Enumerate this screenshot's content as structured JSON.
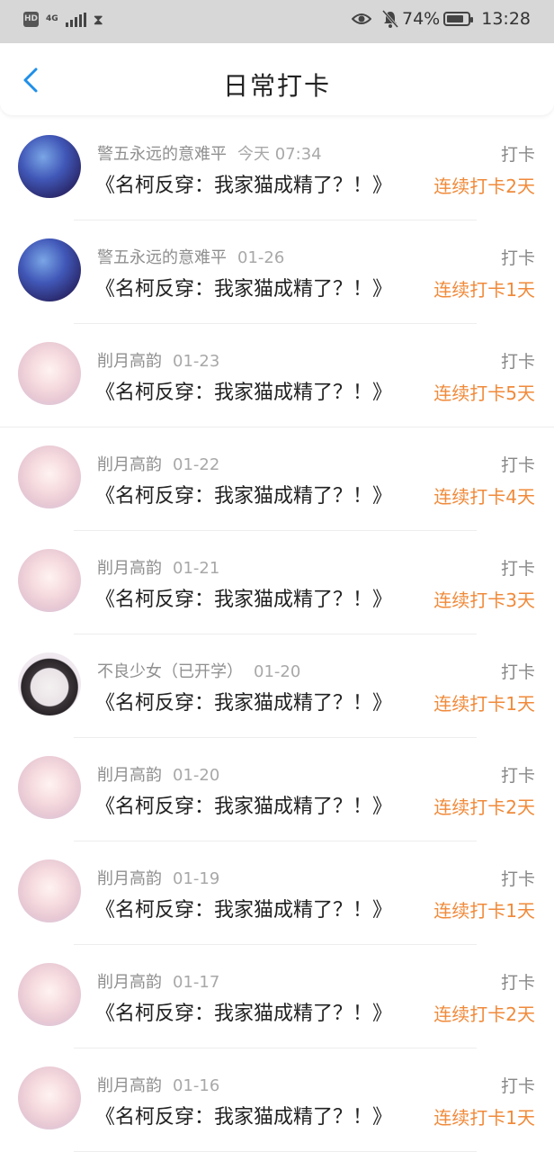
{
  "status_bar": {
    "hd": "HD",
    "network": "4G",
    "battery_percent": "74%",
    "time": "13:28"
  },
  "header": {
    "title": "日常打卡"
  },
  "colors": {
    "accent_blue": "#1f8fe8",
    "streak_orange": "#f08a3a"
  },
  "entries": [
    {
      "user": "警五永远的意难平",
      "date": "今天 07:34",
      "book": "《名柯反穿：我家猫成精了？！》",
      "label": "打卡",
      "streak": "连续打卡2天",
      "avatar": "blue"
    },
    {
      "user": "警五永远的意难平",
      "date": "01-26",
      "book": "《名柯反穿：我家猫成精了？！》",
      "label": "打卡",
      "streak": "连续打卡1天",
      "avatar": "blue"
    },
    {
      "user": "削月高韵",
      "date": "01-23",
      "book": "《名柯反穿：我家猫成精了？！》",
      "label": "打卡",
      "streak": "连续打卡5天",
      "avatar": "pink"
    },
    {
      "user": "削月高韵",
      "date": "01-22",
      "book": "《名柯反穿：我家猫成精了？！》",
      "label": "打卡",
      "streak": "连续打卡4天",
      "avatar": "pink"
    },
    {
      "user": "削月高韵",
      "date": "01-21",
      "book": "《名柯反穿：我家猫成精了？！》",
      "label": "打卡",
      "streak": "连续打卡3天",
      "avatar": "pink"
    },
    {
      "user": "不良少女（已开学）",
      "date": "01-20",
      "book": "《名柯反穿：我家猫成精了？！》",
      "label": "打卡",
      "streak": "连续打卡1天",
      "avatar": "dark"
    },
    {
      "user": "削月高韵",
      "date": "01-20",
      "book": "《名柯反穿：我家猫成精了？！》",
      "label": "打卡",
      "streak": "连续打卡2天",
      "avatar": "pink"
    },
    {
      "user": "削月高韵",
      "date": "01-19",
      "book": "《名柯反穿：我家猫成精了？！》",
      "label": "打卡",
      "streak": "连续打卡1天",
      "avatar": "pink"
    },
    {
      "user": "削月高韵",
      "date": "01-17",
      "book": "《名柯反穿：我家猫成精了？！》",
      "label": "打卡",
      "streak": "连续打卡2天",
      "avatar": "pink"
    },
    {
      "user": "削月高韵",
      "date": "01-16",
      "book": "《名柯反穿：我家猫成精了？！》",
      "label": "打卡",
      "streak": "连续打卡1天",
      "avatar": "pink"
    }
  ]
}
